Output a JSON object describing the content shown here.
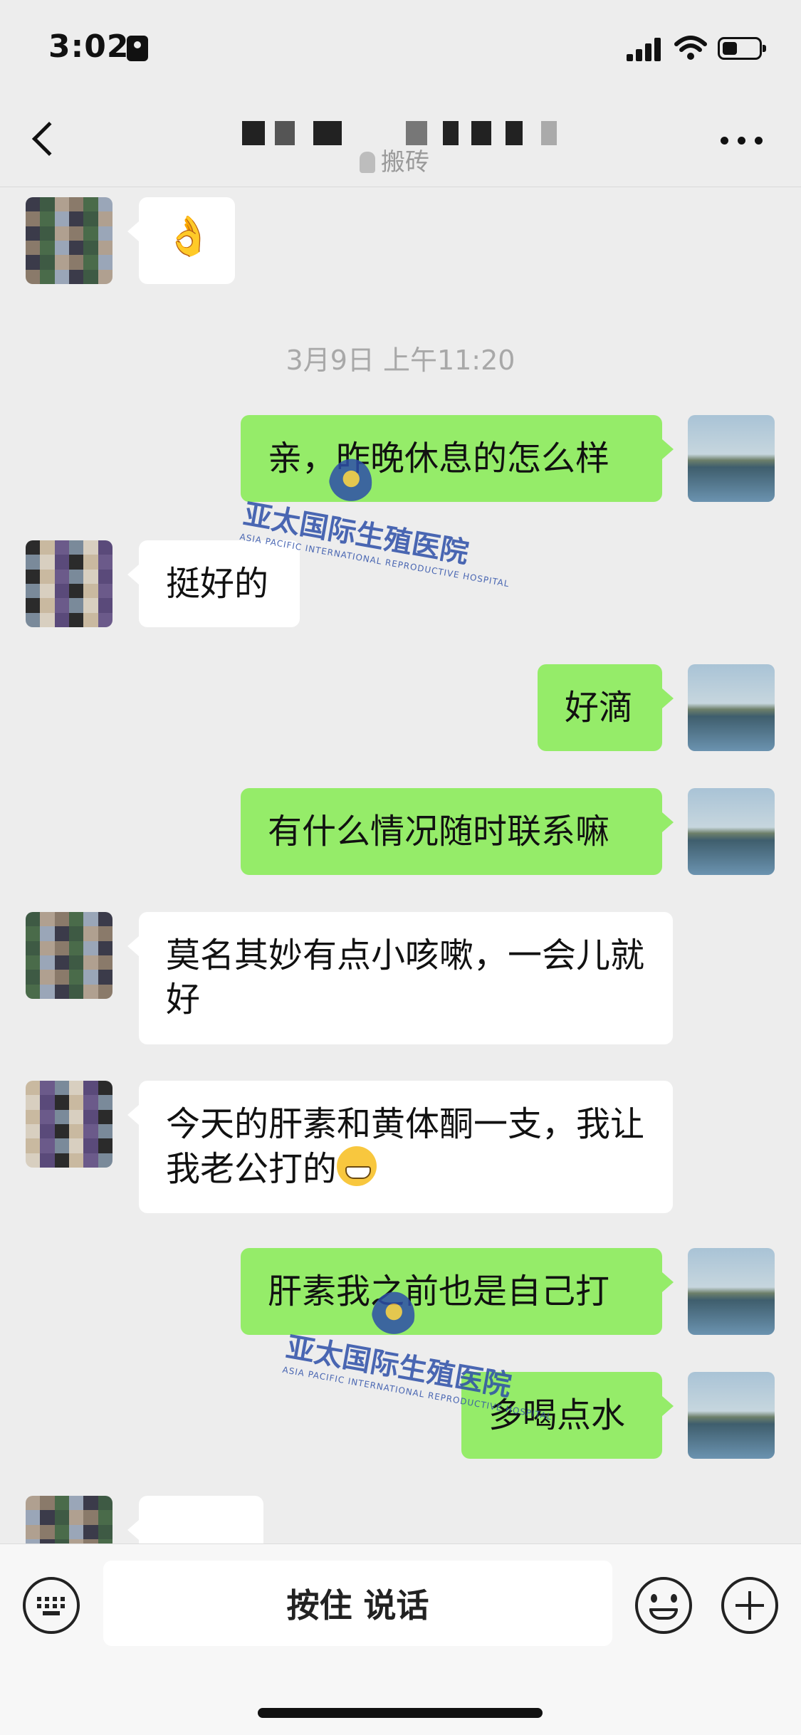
{
  "status_bar": {
    "time": "3:02",
    "battery_level": 0.4
  },
  "header": {
    "subtitle": "搬砖"
  },
  "messages": [
    {
      "side": "in",
      "text": "👌"
    },
    {
      "timestamp": "3月9日 上午11:20"
    },
    {
      "side": "out",
      "text": "亲，昨晚休息的怎么样"
    },
    {
      "side": "in",
      "text": "挺好的"
    },
    {
      "side": "out",
      "text": "好滴"
    },
    {
      "side": "out",
      "text": "有什么情况随时联系嘛"
    },
    {
      "side": "in",
      "text": "莫名其妙有点小咳嗽，一会儿就好"
    },
    {
      "side": "in",
      "text": "今天的肝素和黄体酮一支，我让我老公打的",
      "emoji": "grinning-face"
    },
    {
      "side": "out",
      "text": "肝素我之前也是自己打"
    },
    {
      "side": "out",
      "text": "多喝点水"
    }
  ],
  "watermark": {
    "name": "亚太国际生殖医院",
    "sub": "ASIA PACIFIC INTERNATIONAL REPRODUCTIVE HOSPITAL"
  },
  "input_bar": {
    "voice_label": "按住 说话"
  }
}
